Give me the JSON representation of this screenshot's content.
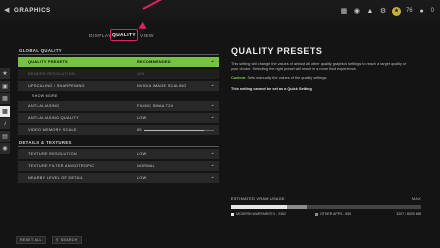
{
  "header": {
    "title": "GRAPHICS",
    "level": "76",
    "count": "0"
  },
  "tabs": [
    {
      "label": "DISPLAY"
    },
    {
      "label": "QUALITY"
    },
    {
      "label": "VIEW"
    }
  ],
  "sections": {
    "global": "GLOBAL QUALITY",
    "details": "DETAILS & TEXTURES"
  },
  "rows": {
    "quality_presets": {
      "label": "QUALITY PRESETS",
      "value": "RECOMMENDED"
    },
    "render_resolution": {
      "label": "RENDER RESOLUTION",
      "value": "100"
    },
    "upscaling": {
      "label": "UPSCALING / SHARPENING",
      "value": "NVIDIA IMAGE SCALING"
    },
    "show_more": "SHOW MORE",
    "anti_aliasing": {
      "label": "ANTI-ALIASING",
      "value": "FILMIC SMAA T2X"
    },
    "aa_quality": {
      "label": "ANTI-ALIASING QUALITY",
      "value": "LOW"
    },
    "video_memory_scale": {
      "label": "VIDEO MEMORY SCALE",
      "value": "85",
      "fraction": 0.85
    },
    "texture_resolution": {
      "label": "TEXTURE RESOLUTION",
      "value": "LOW"
    },
    "texture_filter": {
      "label": "TEXTURE FILTER ANISOTROPIC",
      "value": "NORMAL"
    },
    "nearby_lod": {
      "label": "NEARBY LEVEL OF DETAIL",
      "value": "LOW"
    }
  },
  "description": {
    "title": "QUALITY PRESETS",
    "text": "This setting will change the values of almost all other quality graphics settings to reach a target quality of your choice. Selecting the right preset will result in a more fluid experience.",
    "custom_label": "Custom:",
    "custom_text": "Sets manually the values of the quality settings.",
    "note": "This setting cannot be set as a Quick Setting"
  },
  "vram": {
    "title": "ESTIMATED VRAM USAGE",
    "max_label": "MAX",
    "app_label": "MODERN WARFARE® II : 2352",
    "other_label": "OTHER APPS : 855",
    "total": "3207 / 8000 MB",
    "app_fraction": 0.294,
    "other_fraction": 0.107,
    "app_color": "#e6e6e6",
    "other_color": "#8c8c8c"
  },
  "bottom": {
    "reset": "RESET ALL",
    "search": "SEARCH"
  },
  "colors": {
    "accent_green": "#77c243",
    "highlight_pink": "#e31f63"
  }
}
